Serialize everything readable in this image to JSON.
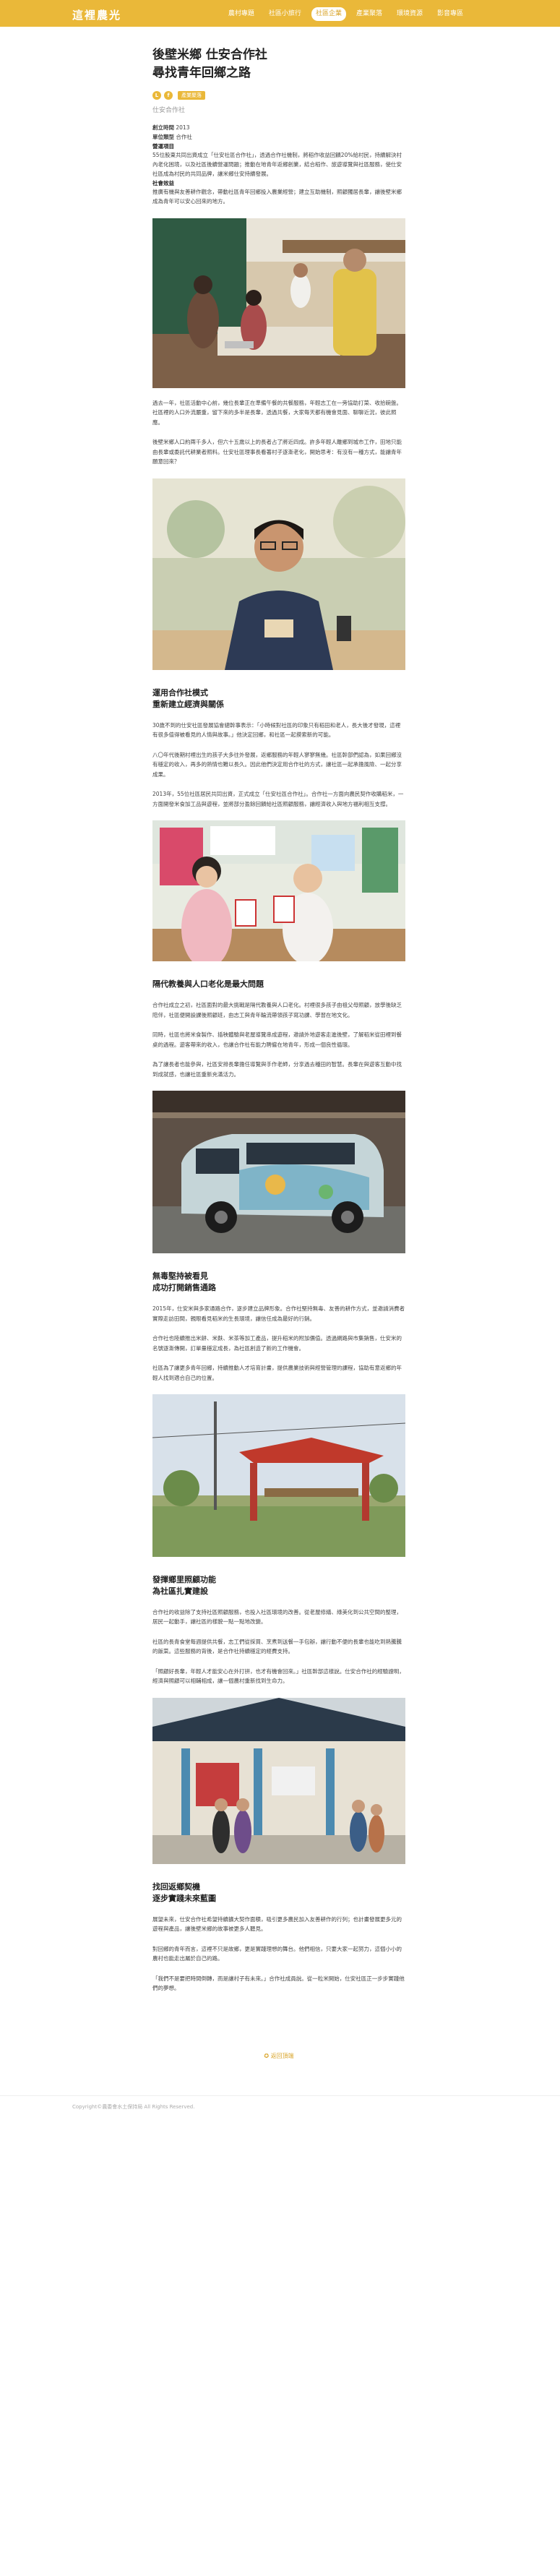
{
  "site": {
    "logo": "這裡農光",
    "nav": [
      "農村專題",
      "社區小旅行",
      "社區企業",
      "產業聚落",
      "環境資源",
      "影音專區"
    ]
  },
  "article": {
    "title_line1": "後壁米鄉 仕安合作社",
    "title_line2": "尋找青年回鄉之路",
    "tag": "產業聚落",
    "subtitle": "仕安合作社",
    "info": {
      "year_label": "創立時間",
      "year": "2013",
      "type_label": "單位類型",
      "type": "合作社",
      "items_label": "營運項目",
      "items": "55位股東共同出資成立「仕安社區合作社」，透過合作社機制，將稻作收益回饋20%給村民，持續解決村內老化困境，以及社區後續營運問題；推動在地青年返鄉創業，結合稻作、旅遊導覽與社區服務，使仕安社區成為村民的共同品牌，讓米鄉仕安持續發展。",
      "feature_label": "社會效益",
      "feature": "推廣有機與友善耕作觀念，帶動社區青年回鄉投入農業經營；建立互助機制，照顧獨居長輩，讓後壁米鄉成為青年可以安心回來的地方。"
    },
    "p1": "過去一年，社區活動中心前，幾位長輩正在準備午餐的共餐服務，年輕志工在一旁協助打菜、收拾碗盤。社區裡的人口外流嚴重，留下來的多半是長輩，透過共餐，大家每天都有機會見面、聊聊近況，彼此照應。",
    "p2": "後壁米鄉人口約兩千多人，但六十五歲以上的長者占了將近四成。許多年輕人離鄉到城市工作，田地只能由長輩或委託代耕業者照料。仕安社區理事長看著村子逐漸老化，開始思考：有沒有一種方式，能讓青年願意回來？",
    "h1_l1": "運用合作社模式",
    "h1_l2": "重新建立經濟與關係",
    "p3": "30歲不到的仕安社區發展協會總幹事表示：「小時候對社區的印象只有稻田和老人，長大後才發現，這裡有很多值得被看見的人情與故事。」他決定回鄉，和社區一起摸索新的可能。",
    "p4": "八〇年代後期村裡出生的孩子大多往外發展，返鄉服務的年輕人寥寥無幾。社區幹部們認為，如果回鄉沒有穩定的收入，再多的熱情也難以長久。因此他們決定用合作社的方式，讓社區一起承擔風險、一起分享成果。",
    "p5": "2013年，55位社區居民共同出資，正式成立「仕安社區合作社」。合作社一方面向農民契作收購稻米，一方面開發米食加工品與遊程，並將部分盈餘回饋給社區照顧服務，讓經濟收入與地方福利相互支撐。",
    "h2": "隔代教養與人口老化是最大問題",
    "p6": "合作社成立之初，社區面對的最大挑戰是隔代教養與人口老化。村裡很多孩子由祖父母照顧，放學後缺乏陪伴，社區便開設課後照顧班，由志工與青年輪流帶領孩子寫功課、學習在地文化。",
    "p7": "同時，社區也將米食製作、插秧體驗與老屋導覽串成遊程，邀請外地遊客走進後壁，了解稻米從田裡到餐桌的過程。遊客帶來的收入，也讓合作社有能力聘僱在地青年，形成一個良性循環。",
    "p8": "為了讓長者也能參與，社區安排長輩擔任導覽與手作老師，分享過去種田的智慧。長輩在與遊客互動中找到成就感，也讓社區重新充滿活力。",
    "h3_l1": "無毒堅持被看見",
    "h3_l2": "成功打開銷售通路",
    "p9": "2015年，仕安米與多家通路合作，逐步建立品牌形象。合作社堅持無毒、友善的耕作方式，並邀請消費者實際走訪田間，親眼看見稻米的生長環境，讓信任成為最好的行銷。",
    "p10": "合作社也陸續推出米餅、米麩、米茶等加工產品，提升稻米的附加價值。透過網路與市集銷售，仕安米的名號逐漸傳開，訂單量穩定成長，為社區創造了新的工作機會。",
    "p11": "社區為了讓更多青年回鄉，持續推動人才培育計畫，提供農業技術與經營管理的課程，協助有意返鄉的年輕人找到適合自己的位置。",
    "h4_l1": "發揮鄉里照顧功能",
    "h4_l2": "為社區扎實建設",
    "p12": "合作社的收益除了支持社區照顧服務，也投入社區環境的改善。從老屋修繕、綠美化到公共空間的整理，居民一起動手，讓社區的樣貌一點一點地改變。",
    "p13": "社區的長青食堂每週提供共餐，志工們從採買、烹煮到送餐一手包辦，讓行動不便的長輩也能吃到熱騰騰的飯菜。這些服務的背後，是合作社持續穩定的經費支持。",
    "p14": "「照顧好長輩，年輕人才能安心在外打拼，也才有機會回來。」社區幹部這樣說。仕安合作社的經驗證明，經濟與照顧可以相輔相成，讓一個農村重新找到生命力。",
    "h5_l1": "找回返鄉契機",
    "h5_l2": "逐步實踐未來藍圖",
    "p15": "展望未來，仕安合作社希望持續擴大契作面積，吸引更多農民加入友善耕作的行列；也計畫發展更多元的遊程與產品，讓後壁米鄉的故事被更多人聽見。",
    "p16": "對回鄉的青年而言，這裡不只是故鄉，更是實踐理想的舞台。他們相信，只要大家一起努力，這個小小的農村也能走出屬於自己的路。",
    "p17": "「我們不是要把時間倒轉，而是讓村子有未來。」合作社成員說。從一粒米開始，仕安社區正一步步實踐他們的夢想。",
    "end_link": "返回頂端"
  },
  "footer": "Copyright©農委會水土保持局 All Rights Reserved."
}
